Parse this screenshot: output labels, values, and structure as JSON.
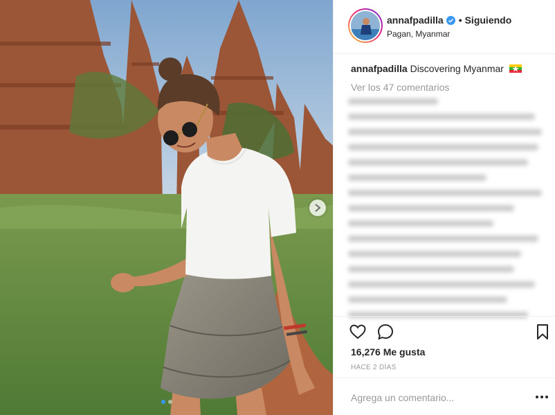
{
  "header": {
    "username": "annafpadilla",
    "separator": "•",
    "follow_label": "Siguiendo",
    "location": "Pagan, Myanmar"
  },
  "caption": {
    "username": "annafpadilla",
    "text": "Discovering Myanmar"
  },
  "view_comments": "Ver los 47 comentarios",
  "likes": "16,276 Me gusta",
  "timestamp": "HACE 2 DÍAS",
  "comment_box": {
    "placeholder": "Agrega un comentario..."
  },
  "carousel": {
    "slides": 2,
    "active": 1
  },
  "icons": {
    "verified": "verified-badge-icon",
    "like": "heart-icon",
    "comment": "comment-bubble-icon",
    "save": "bookmark-icon",
    "more": "more-options-icon",
    "next": "chevron-right-icon",
    "flag": "myanmar-flag-icon"
  },
  "colors": {
    "verified": "#3897f0",
    "active_dot": "#3897f0",
    "muted_text": "#999999",
    "text": "#262626"
  }
}
